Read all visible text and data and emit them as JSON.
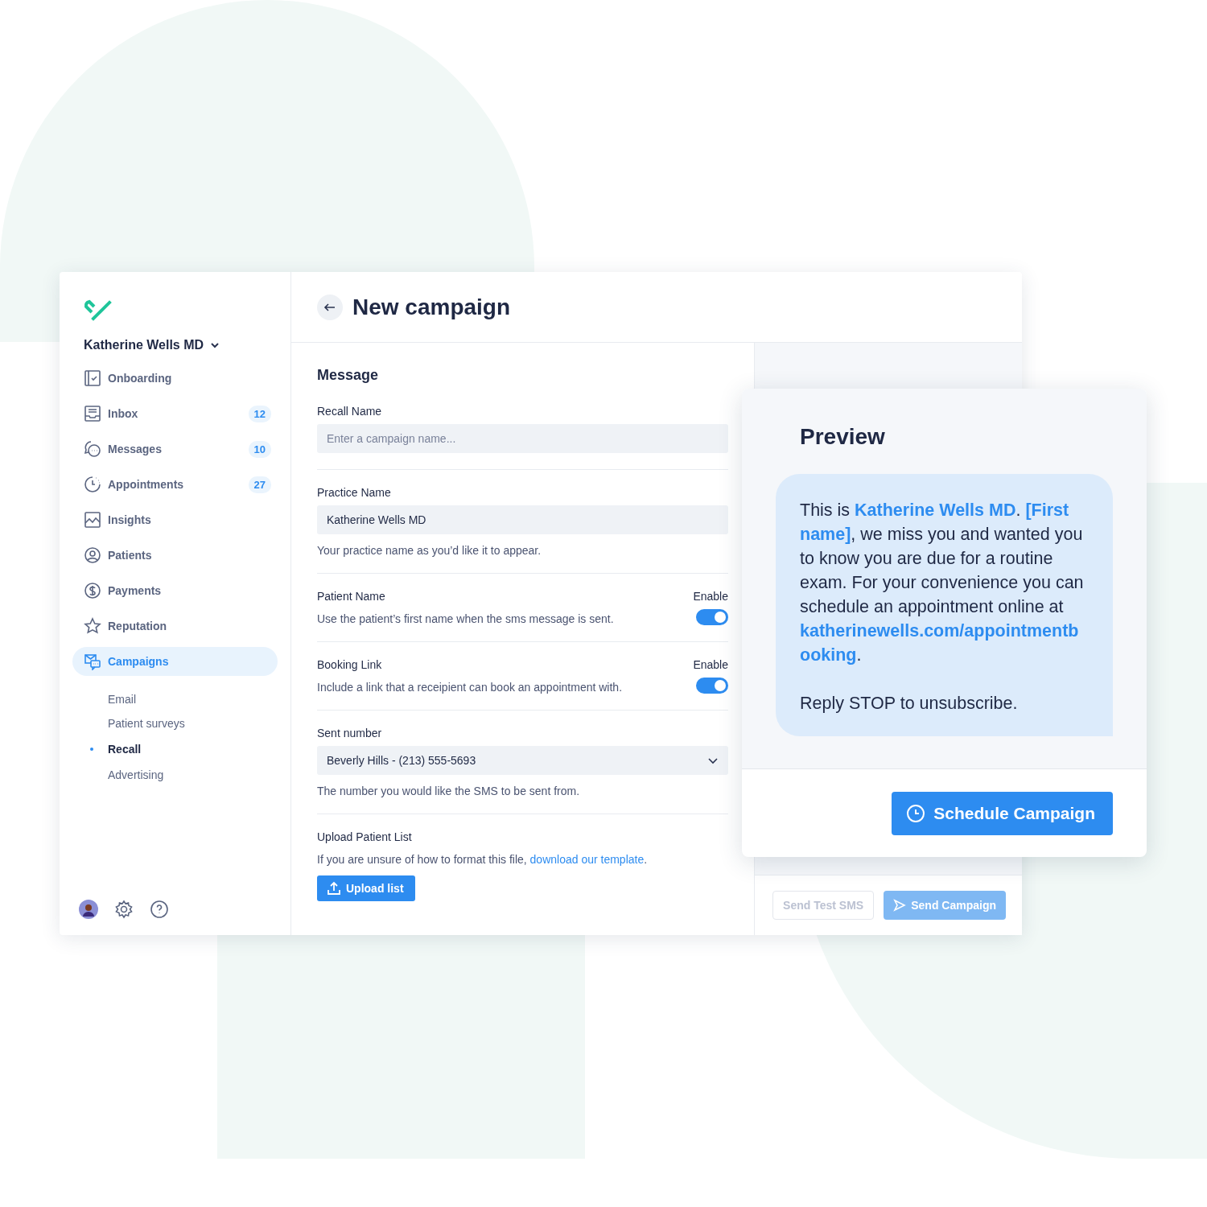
{
  "sidebar": {
    "account": "Katherine Wells MD",
    "items": [
      {
        "label": "Onboarding",
        "selected": false
      },
      {
        "label": "Inbox",
        "badge": "12",
        "selected": false
      },
      {
        "label": "Messages",
        "badge": "10",
        "selected": false
      },
      {
        "label": "Appointments",
        "badge": "27",
        "selected": false
      },
      {
        "label": "Insights",
        "selected": false
      },
      {
        "label": "Patients",
        "selected": false
      },
      {
        "label": "Payments",
        "selected": false
      },
      {
        "label": "Reputation",
        "selected": false
      },
      {
        "label": "Campaigns",
        "selected": true,
        "children": [
          {
            "label": "Email",
            "selected": false
          },
          {
            "label": "Patient surveys",
            "selected": false
          },
          {
            "label": "Recall",
            "selected": true
          },
          {
            "label": "Advertising",
            "selected": false
          }
        ]
      }
    ]
  },
  "header": {
    "title": "New campaign"
  },
  "form": {
    "title": "Message",
    "fields": [
      {
        "kind": "text",
        "label": "Recall Name",
        "placeholder": "Enter a campaign name..."
      },
      {
        "kind": "text",
        "label": "Practice Name",
        "value": "Katherine Wells MD",
        "help": "Your practice name as you’d like it to appear."
      },
      {
        "kind": "toggle",
        "label": "Patient Name",
        "toggle_label": "Enable",
        "help": "Use the patient’s first name when the sms message is sent.",
        "on": true
      },
      {
        "kind": "toggle",
        "label": "Booking Link",
        "toggle_label": "Enable",
        "help": "Include a link that a receipient can book an appointment with.",
        "on": true
      },
      {
        "kind": "select",
        "label": "Sent number",
        "value": "Beverly Hills - (213) 555-5693",
        "help": "The number you would like the SMS to be sent from."
      },
      {
        "kind": "upload",
        "label": "Upload Patient List",
        "help": "If you are unsure of how to format this file,",
        "link": "download our template",
        "help_end": ".",
        "button": "Upload list"
      }
    ]
  },
  "footer": {
    "buttons": [
      {
        "label": "Send Test SMS",
        "kind": "secondary",
        "disabled": true
      },
      {
        "label": "Send Campaign",
        "kind": "primary",
        "disabled": true
      }
    ]
  },
  "preview": {
    "title": "Preview",
    "message": "This is **Katherine Wells MD**. **[First name]**, we miss you and wanted you to know you are due for a routine exam. For your convenience you can schedule an appointment online at **katherinewells.com/appointmentbooking**.",
    "closing": "Reply STOP to unsubscribe.",
    "button": "Schedule Campaign"
  }
}
